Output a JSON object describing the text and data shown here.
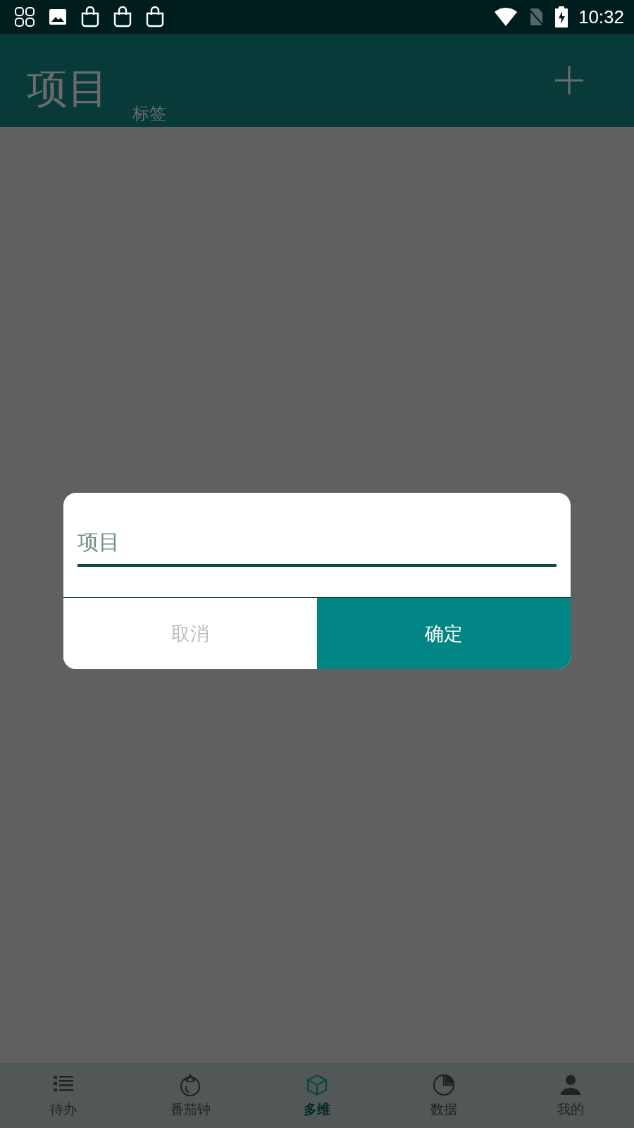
{
  "status_bar": {
    "time": "10:32"
  },
  "header": {
    "tabs": [
      {
        "label": "项目",
        "selected": true
      },
      {
        "label": "标签",
        "selected": false
      }
    ]
  },
  "dialog": {
    "input": {
      "placeholder": "项目"
    },
    "buttons": [
      {
        "label": "取消",
        "kind": "cancel"
      },
      {
        "label": "确定",
        "kind": "confirm"
      }
    ]
  },
  "bottom_nav": [
    {
      "label": "待办",
      "selected": false
    },
    {
      "label": "番茄钟",
      "selected": false
    },
    {
      "label": "多维",
      "selected": true
    },
    {
      "label": "数据",
      "selected": false
    },
    {
      "label": "我的",
      "selected": false
    }
  ]
}
